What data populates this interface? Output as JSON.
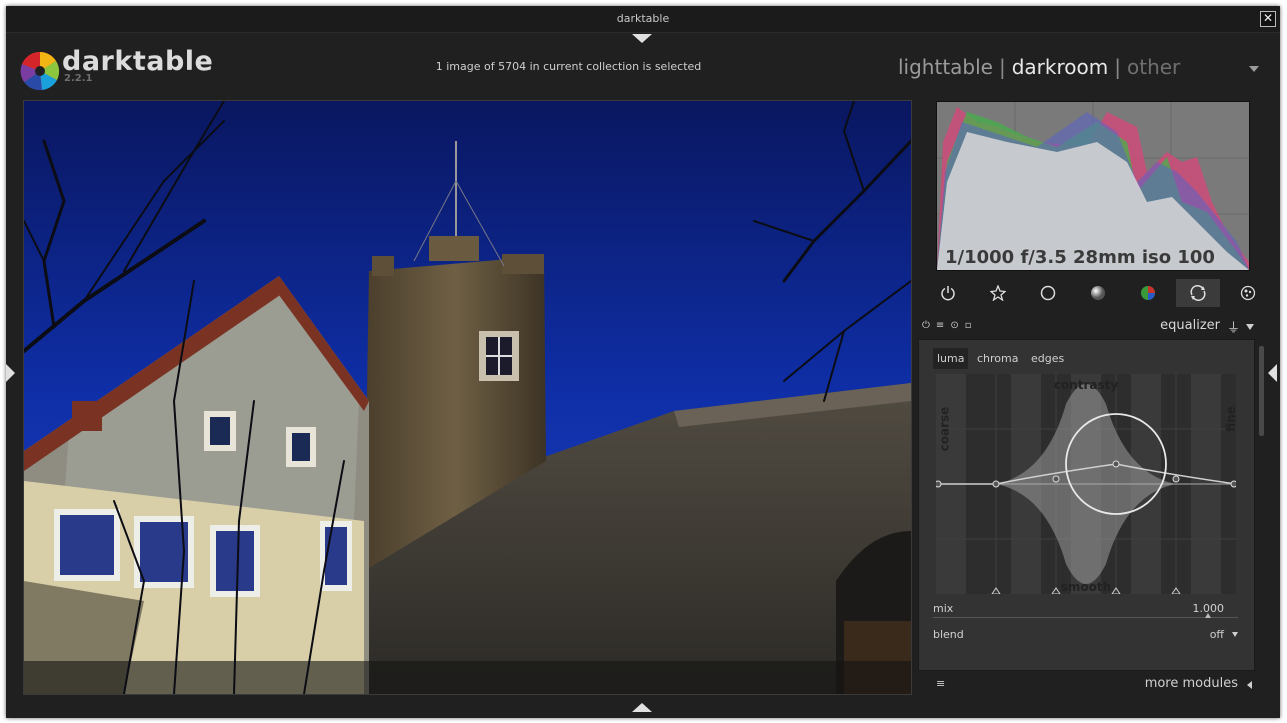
{
  "window": {
    "title": "darktable",
    "close_label": "✕"
  },
  "header": {
    "brand": "darktable",
    "version": "2.2.1",
    "collection_status": "1 image of 5704 in current collection is selected",
    "views": {
      "lighttable": "lighttable",
      "separator": "|",
      "darkroom": "darkroom",
      "other": "other"
    }
  },
  "histogram": {
    "exif": "1/1000 f/3.5 28mm iso 100"
  },
  "module_groups": [
    "power-icon",
    "star-icon",
    "circle-icon",
    "shaded-circle-icon",
    "color-circle-icon",
    "correct-icon",
    "effect-icon"
  ],
  "module": {
    "name": "equalizer",
    "tabs": [
      "luma",
      "chroma",
      "edges"
    ],
    "active_tab": "luma",
    "graph": {
      "top_label": "contrasty",
      "bottom_label": "smooth",
      "left_label": "coarse",
      "right_label": "fine"
    },
    "mix_label": "mix",
    "mix_value": "1.000",
    "mix_level": 0.9,
    "blend_label": "blend",
    "blend_value": "off"
  },
  "footer": {
    "more_modules": "more modules"
  },
  "colors": {
    "background": "#202020",
    "panel": "#333333",
    "accent": "#e8e8e8"
  }
}
